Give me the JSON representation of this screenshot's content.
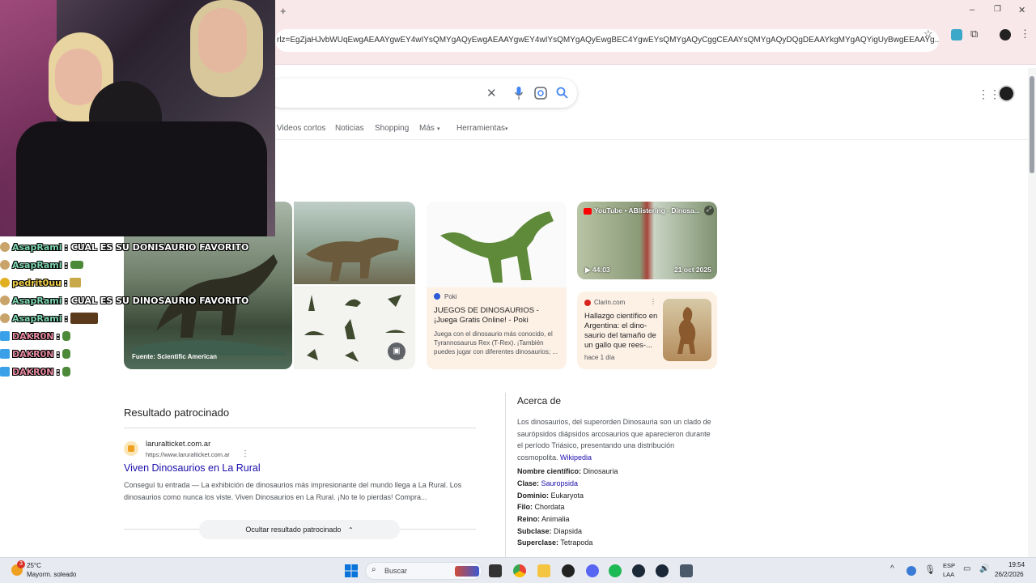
{
  "browser": {
    "url": "rlz=EgZjaHJvbWUqEwgAEAAYgwEY4wIYsQMYgAQyEwgAEAAYgwEY4wIYsQMYgAQyEwgBEC4YgwEYsQMYgAQyCggCEAAYsQMYgAQyDQgDEAAYkgMYgAQYigUyBwgEEAAYg...",
    "new_tab_symbol": "+",
    "window_controls": [
      "–",
      "❐",
      "✕"
    ]
  },
  "search": {
    "tabs": [
      "Videos cortos",
      "Noticias",
      "Shopping",
      "Más",
      "Herramientas"
    ],
    "image_caption": "Fuente: Scientific American",
    "card_poki": {
      "source": "Poki",
      "title": "JUEGOS DE DINOSAURIOS - ¡Juega Gratis Online! - Poki",
      "snippet": "Juega con el dinosaurio más conocido, el Tyrannosaurus Rex (T-Rex). ¡También puedes jugar con diferentes dinosaurios; ..."
    },
    "card_youtube": {
      "source": "YouTube • ABlistering - Dinosa...",
      "duration": "44:03",
      "date": "21 oct 2025"
    },
    "card_clarin": {
      "source": "Clarin.com",
      "title": "Hallazgo científico en Argentina: el dino-saurio del tamaño de un gallo que rees-...",
      "time": "hace 1 día"
    },
    "sponsored": {
      "heading": "Resultado patrocinado",
      "domain": "laruralticket.com.ar",
      "url": "https://www.laruralticket.com.ar",
      "title": "Viven Dinosaurios en La Rural",
      "snippet": "Conseguí tu entrada — La exhibición de dinosaurios más impresionante del mundo llega a La Rural. Los dinosaurios como nunca los viste. Viven Dinosaurios en La Rural. ¡No te lo pierdas! Compra...",
      "hide_label": "Ocultar resultado patrocinado"
    },
    "knowledge": {
      "heading": "Acerca de",
      "description": "Los dinosaurios, del superorden Dinosauria son un clado de saurópsidos diápsidos arcosaurios que aparecieron durante el período Triásico, presentando una distribución cosmopolita.",
      "wiki_link": "Wikipedia",
      "facts": [
        {
          "label": "Nombre científico:",
          "value": "Dinosauria"
        },
        {
          "label": "Clase:",
          "value": "Sauropsida"
        },
        {
          "label": "Dominio:",
          "value": "Eukaryota"
        },
        {
          "label": "Filo:",
          "value": "Chordata"
        },
        {
          "label": "Reino:",
          "value": "Animalia"
        },
        {
          "label": "Subclase:",
          "value": "Diapsida"
        },
        {
          "label": "Superclase:",
          "value": "Tetrapoda"
        }
      ]
    }
  },
  "chat": [
    {
      "user": "AsapRami",
      "msg": ": CUAL ES SU DONISAURIO FAVORITO",
      "color": "#7fd6b2",
      "badge": "#c9a46a"
    },
    {
      "user": "AsapRami",
      "msg": ":",
      "color": "#7fd6b2",
      "badge": "#c9a46a"
    },
    {
      "user": "pedrit0uu",
      "msg": ":",
      "color": "#f2d04a",
      "badge": "#e0b020"
    },
    {
      "user": "AsapRami",
      "msg": ": CUAL ES SU DINOSAURIO FAVORITO",
      "color": "#7fd6b2",
      "badge": "#c9a46a"
    },
    {
      "user": "AsapRami",
      "msg": ":",
      "color": "#7fd6b2",
      "badge": "#c9a46a"
    },
    {
      "user": "DAKR0N",
      "msg": ":",
      "color": "#e88aa0",
      "badge": "#3aa0e8"
    },
    {
      "user": "DAKR0N",
      "msg": ":",
      "color": "#e88aa0",
      "badge": "#3aa0e8"
    },
    {
      "user": "DAKR0N",
      "msg": ":",
      "color": "#e88aa0",
      "badge": "#3aa0e8"
    }
  ],
  "taskbar": {
    "weather_temp": "25°C",
    "weather_desc": "Mayorm. soleado",
    "weather_badge": "3",
    "search_placeholder": "Buscar",
    "lang": "ESP",
    "lang2": "LAA",
    "time": "19:54",
    "date": "26/2/2026"
  }
}
